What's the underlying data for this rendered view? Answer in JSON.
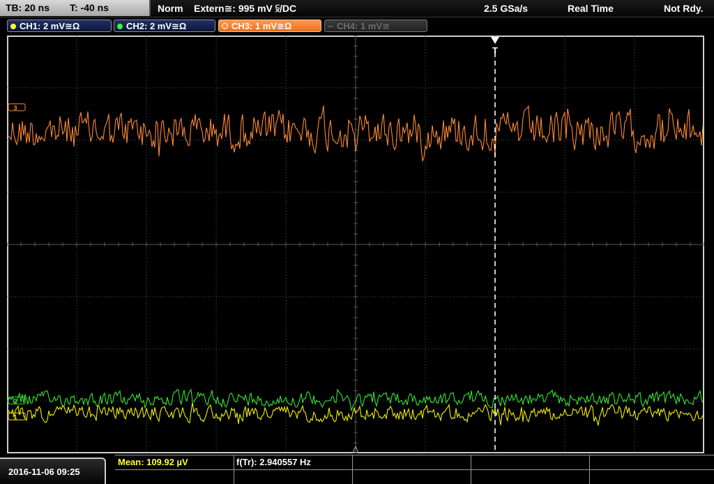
{
  "status_bar": {
    "timebase": "TB: 20 ns",
    "trigger_time": "T: -40 ns",
    "trigger_mode": "Norm",
    "trigger_source": "Extern≅: 995 mV ⫁/DC",
    "sample_rate": "2.5 GSa/s",
    "acquisition_mode": "Real Time",
    "run_state": "Not Rdy."
  },
  "channels": [
    {
      "label": "CH1: 2 mV≅Ω",
      "color": "#ffff33",
      "state": "on"
    },
    {
      "label": "CH2: 2 mV≅Ω",
      "color": "#33ff33",
      "state": "on"
    },
    {
      "label": "CH3: 1 mV≅Ω",
      "color": "#ff8c3a",
      "state": "selected"
    },
    {
      "label": "CH4: 1 mV≅",
      "color": "#666666",
      "state": "off"
    }
  ],
  "markers": {
    "trigger_marker": "T",
    "ch3_offset_marker": "3",
    "ch2_offset_marker": "2",
    "ch1_offset_marker": "1"
  },
  "colors": {
    "ch1": "#f2f200",
    "ch2": "#33e633",
    "ch3": "#ff8a33",
    "grid": "#5a5a5a",
    "trigger_line": "#ffffff",
    "measurement_text": "#ffff33"
  },
  "datetime": "2016-11-06 09:25",
  "measurements": {
    "mean": "Mean: 109.92 µV",
    "frequency": "f(Tr): 2.940557 Hz"
  }
}
